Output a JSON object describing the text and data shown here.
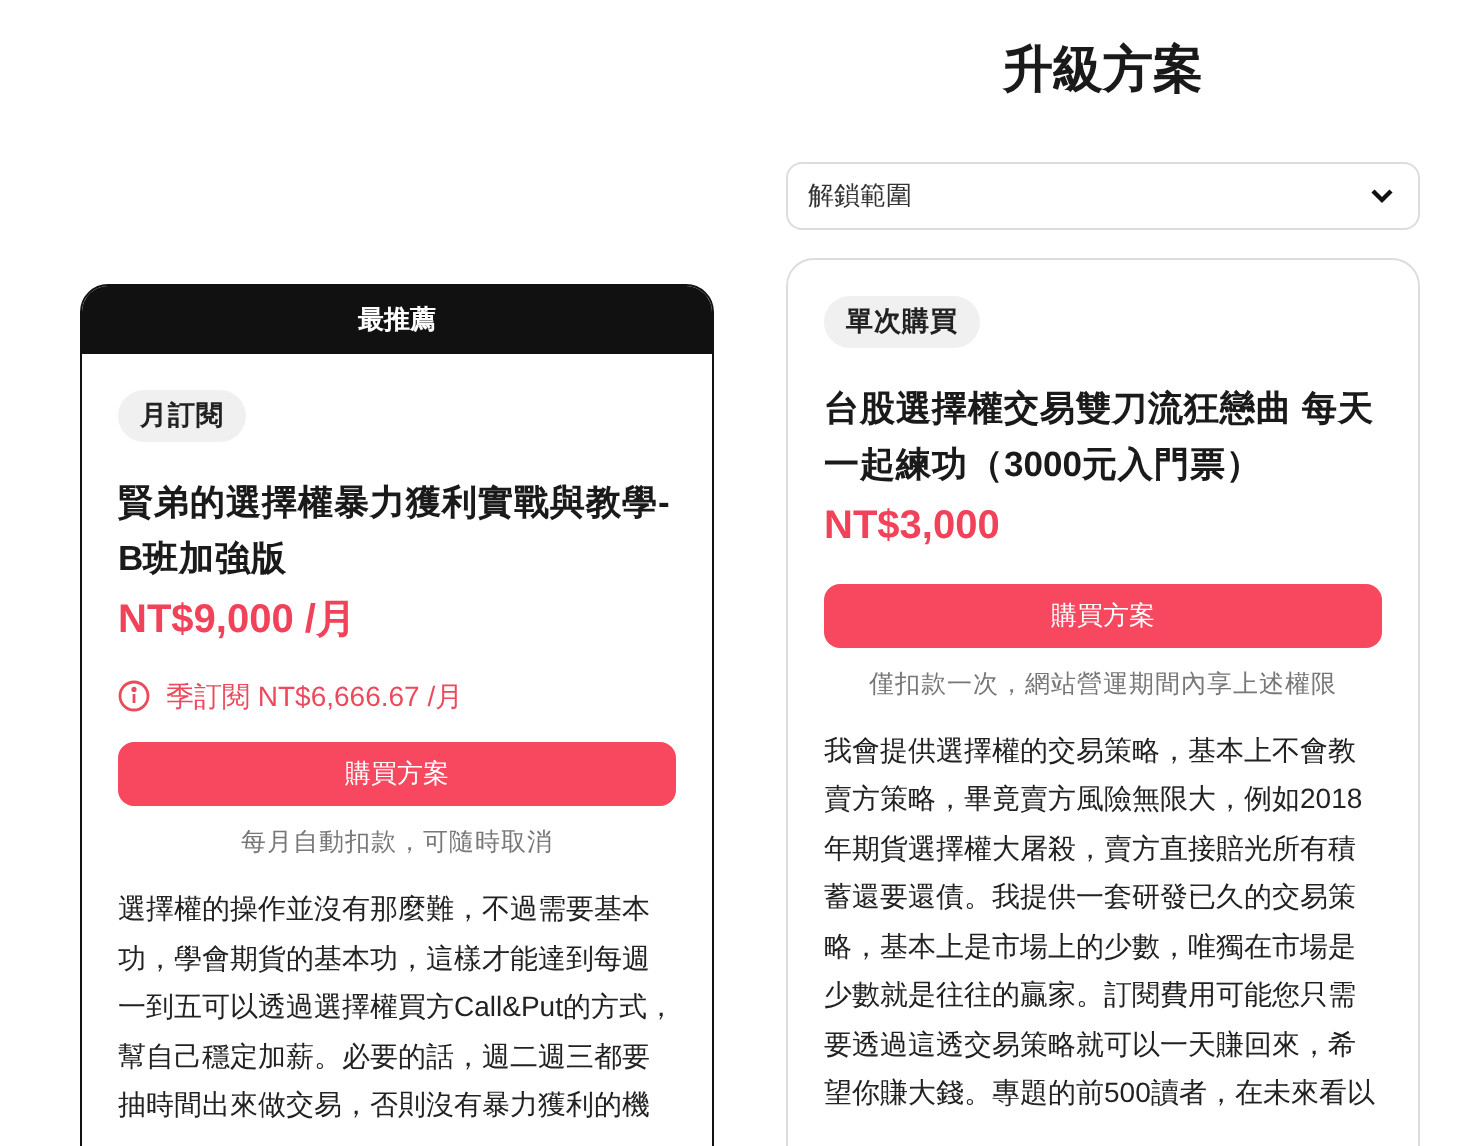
{
  "page": {
    "title": "升級方案"
  },
  "filter": {
    "value": "解鎖範圍"
  },
  "plans": [
    {
      "ribbon": "最推薦",
      "badge": "月訂閱",
      "name": "賢弟的選擇權暴力獲利實戰與教學-B班加強版",
      "price": "NT$9,000 /月",
      "alt_price": "季訂閱 NT$6,666.67 /月",
      "button": "購買方案",
      "note": "每月自動扣款，可隨時取消",
      "description": [
        "選擇權的操作並沒有那麼難，不過需要基本",
        "功，學會期貨的基本功，這樣才能達到每週",
        "一到五可以透過選擇權買方Call&Put的方式，",
        "幫自己穩定加薪。必要的話，週二週三都要",
        "抽時間出來做交易，否則沒有暴力獲利的機"
      ]
    },
    {
      "badge": "單次購買",
      "name": "台股選擇權交易雙刀流狂戀曲 每天一起練功（3000元入門票）",
      "price": "NT$3,000",
      "button": "購買方案",
      "note": "僅扣款一次，網站營運期間內享上述權限",
      "description": [
        "我會提供選擇權的交易策略，基本上不會教",
        "賣方策略，畢竟賣方風險無限大，例如2018",
        "年期貨選擇權大屠殺，賣方直接賠光所有積",
        "蓄還要還債。我提供一套研發已久的交易策",
        "略，基本上是市場上的少數，唯獨在市場是",
        "少數就是往往的贏家。訂閱費用可能您只需",
        "要透過這透交易策略就可以一天賺回來，希",
        "望你賺大錢。專題的前500讀者，在未來看以"
      ]
    }
  ]
}
